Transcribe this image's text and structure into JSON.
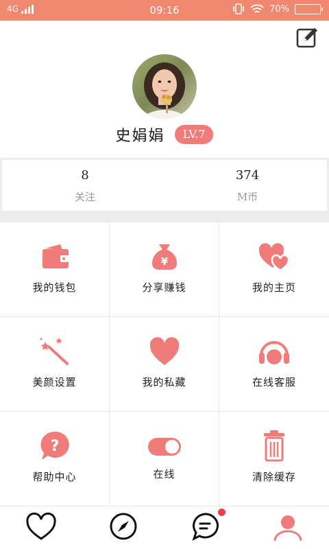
{
  "status_bar": {
    "network": "4G",
    "time": "09:16",
    "battery_percent": "70%",
    "battery_level": 0.7
  },
  "profile": {
    "name": "史娟娟",
    "level": "LV.7"
  },
  "stats": [
    {
      "value": "8",
      "label": "关注"
    },
    {
      "value": "374",
      "label": "M币"
    }
  ],
  "menu": [
    {
      "label": "我的钱包",
      "icon": "wallet-icon"
    },
    {
      "label": "分享赚钱",
      "icon": "money-bag-icon"
    },
    {
      "label": "我的主页",
      "icon": "hearts-icon"
    },
    {
      "label": "美颜设置",
      "icon": "magic-wand-icon"
    },
    {
      "label": "我的私藏",
      "icon": "heart-icon"
    },
    {
      "label": "在线客服",
      "icon": "headphones-icon"
    },
    {
      "label": "帮助中心",
      "icon": "question-bubble-icon"
    },
    {
      "label": "在线",
      "icon": "toggle-icon"
    },
    {
      "label": "清除缓存",
      "icon": "trash-icon"
    }
  ],
  "tabs": [
    {
      "icon": "heart-outline-icon"
    },
    {
      "icon": "compass-icon"
    },
    {
      "icon": "chat-icon",
      "badge": true
    },
    {
      "icon": "profile-icon",
      "active": true
    }
  ],
  "colors": {
    "accent": "#f07b7b",
    "status_bar": "#f0876f",
    "badge": "#ee3f4f"
  }
}
